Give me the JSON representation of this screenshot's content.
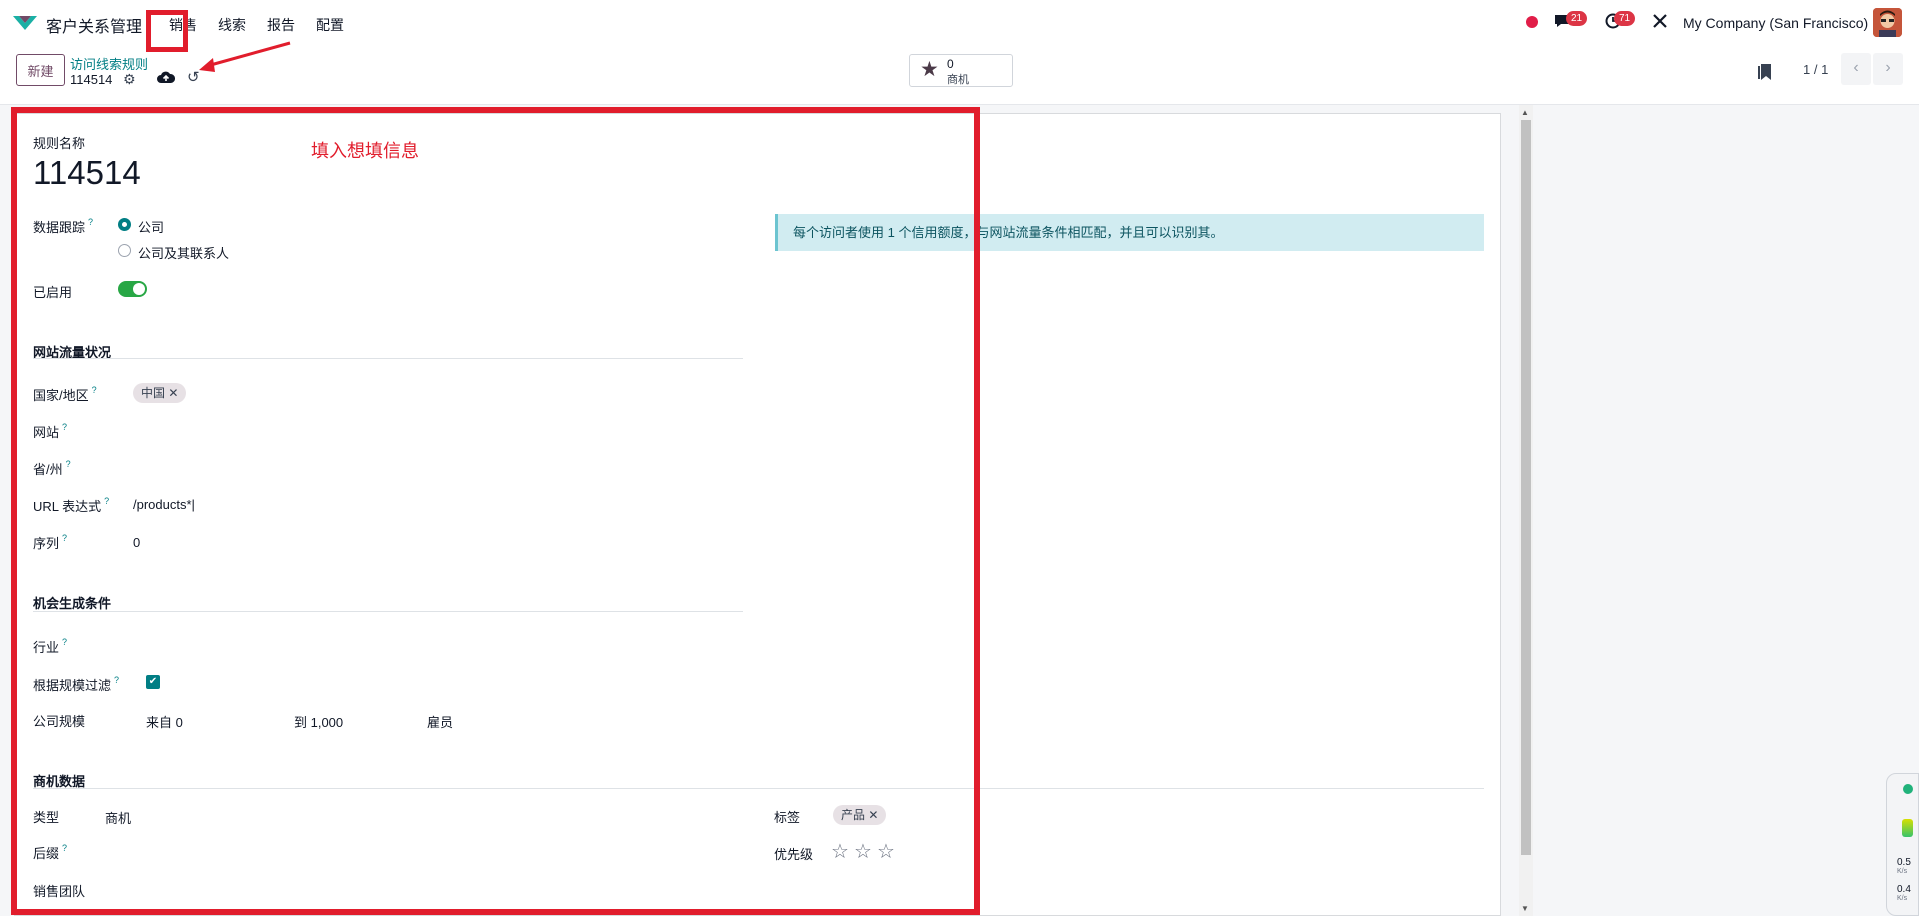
{
  "nav": {
    "app_title": "客户关系管理",
    "menu": [
      "销售",
      "线索",
      "报告",
      "配置"
    ],
    "messages_count": "21",
    "activities_count": "71",
    "company": "My Company (San Francisco)"
  },
  "control": {
    "new_label": "新建",
    "breadcrumb": "访问线索规则",
    "record_id": "114514",
    "stat_value": "0",
    "stat_label": "商机",
    "pager": "1 / 1"
  },
  "annotation": "填入想填信息",
  "form": {
    "name_label": "规则名称",
    "name_value": "114514",
    "tracking_label": "数据跟踪",
    "tracking_options": [
      "公司",
      "公司及其联系人"
    ],
    "tracking_selected": "公司",
    "active_label": "已启用",
    "active": true,
    "info_text": "每个访问者使用 1 个信用额度，与网站流量条件相匹配，并且可以识别其。",
    "traffic_section": "网站流量状况",
    "country_label": "国家/地区",
    "country_tag": "中国",
    "website_label": "网站",
    "state_label": "省/州",
    "url_label": "URL 表达式",
    "url_value": "/products*|",
    "sequence_label": "序列",
    "sequence_value": "0",
    "opportunity_section": "机会生成条件",
    "industry_label": "行业",
    "filter_size_label": "根据规模过滤",
    "filter_size": true,
    "company_size_label": "公司规模",
    "size_from": "来自 0",
    "size_to": "到 1,000",
    "size_unit": "雇员",
    "lead_section": "商机数据",
    "type_label": "类型",
    "type_value": "商机",
    "suffix_label": "后缀",
    "team_label": "销售团队",
    "tags_label": "标签",
    "tag_value": "产品",
    "priority_label": "优先级",
    "priority_stars": 3
  },
  "widget": {
    "up": "0.5",
    "up_unit": "K/s",
    "down": "0.4",
    "down_unit": "K/s"
  }
}
